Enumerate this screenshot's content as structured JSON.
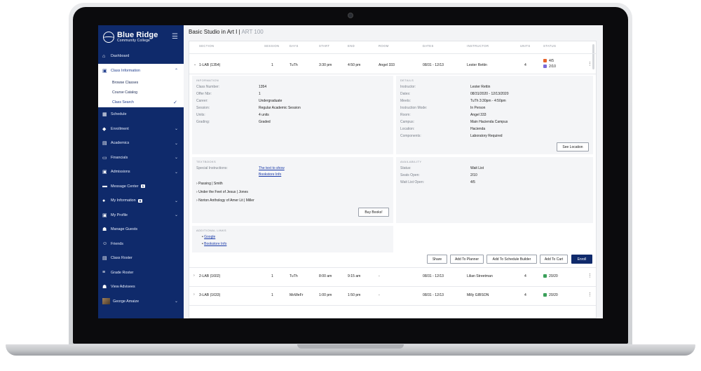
{
  "app": {
    "logo_line1": "Blue Ridge",
    "logo_line2": "Community College",
    "title": "Basic Studio in Art I",
    "course_code": "ART 100"
  },
  "colors": {
    "brand": "#0f2a6b",
    "link": "#1a3aa8",
    "waitlist": "#e8632a",
    "open": "#3aa05a",
    "seats": "#7a6ad8"
  },
  "sidebar": {
    "items": [
      {
        "label": "Dashboard",
        "icon": "home-icon"
      },
      {
        "label": "Class Information",
        "icon": "book-icon"
      },
      {
        "label": "Schedule",
        "icon": "calendar-icon"
      },
      {
        "label": "Enrollment",
        "icon": "graduation-cap-icon"
      },
      {
        "label": "Academics",
        "icon": "library-icon"
      },
      {
        "label": "Financials",
        "icon": "card-icon"
      },
      {
        "label": "Admissions",
        "icon": "id-card-icon"
      },
      {
        "label": "Message Center",
        "icon": "message-icon",
        "badge": "1"
      },
      {
        "label": "My Information",
        "icon": "info-icon",
        "badge": "8"
      },
      {
        "label": "My Profile",
        "icon": "profile-icon"
      },
      {
        "label": "Manage Guests",
        "icon": "guests-icon"
      },
      {
        "label": "Friends",
        "icon": "smile-icon"
      },
      {
        "label": "Class Roster",
        "icon": "roster-icon"
      },
      {
        "label": "Grade Roster",
        "icon": "grade-icon"
      },
      {
        "label": "View Advisees",
        "icon": "advisees-icon"
      },
      {
        "label": "George Amaize",
        "icon": "avatar"
      }
    ],
    "sub_items": [
      "Browse Classes",
      "Course Catalog",
      "Class Search"
    ]
  },
  "table": {
    "headers": [
      "SECTION",
      "SESSION",
      "DAYS",
      "START",
      "END",
      "ROOM",
      "DATES",
      "INSTRUCTOR",
      "UNITS",
      "STATUS"
    ],
    "rows": [
      {
        "section": "1-LAB (1354)",
        "session": "1",
        "days": "TuTh",
        "start": "3:30 pm",
        "end": "4:50 pm",
        "room": "Angel 333",
        "dates": "08/31 - 12/13",
        "instructor": "Lester Rettin",
        "units": "4",
        "status1": "4/5",
        "status2": "2/10"
      },
      {
        "section": "2-LAB (1602)",
        "session": "1",
        "days": "TuTh",
        "start": "8:00 am",
        "end": "9:15 am",
        "room": "-",
        "dates": "08/31 - 12/13",
        "instructor": "Lilian Streetman",
        "units": "4",
        "status1": "20/20"
      },
      {
        "section": "3-LAB (1633)",
        "session": "1",
        "days": "MoWeFr",
        "start": "1:00 pm",
        "end": "1:50 pm",
        "room": "-",
        "dates": "08/31 - 12/13",
        "instructor": "Milly GIBSON",
        "units": "4",
        "status1": "20/20"
      }
    ]
  },
  "information": {
    "title": "INFORMATION",
    "fields": [
      {
        "label": "Class Number:",
        "value": "1354"
      },
      {
        "label": "Offer Nbr:",
        "value": "1"
      },
      {
        "label": "Career:",
        "value": "Undergraduate"
      },
      {
        "label": "Session:",
        "value": "Regular Academic Session"
      },
      {
        "label": "Units:",
        "value": "4 units"
      },
      {
        "label": "Grading:",
        "value": "Graded"
      }
    ]
  },
  "details": {
    "title": "DETAILS",
    "fields": [
      {
        "label": "Instructor:",
        "value": "Lester Rettin"
      },
      {
        "label": "Dates:",
        "value": "08/31/2020 - 12/13/2020"
      },
      {
        "label": "Meets:",
        "value": "TuTh 3:30pm - 4:50pm"
      },
      {
        "label": "Instruction Mode:",
        "value": "In Person"
      },
      {
        "label": "Room:",
        "value": "Angel 333"
      },
      {
        "label": "Campus:",
        "value": "Main Hacienda Campus"
      },
      {
        "label": "Location:",
        "value": "Hacienda"
      },
      {
        "label": "Components:",
        "value": "Laboratory Required"
      }
    ],
    "see_location": "See Location"
  },
  "textbooks": {
    "title": "TEXTBOOKS",
    "instructions_label": "Special Instructions:",
    "link1": "The text to show",
    "link2": "Bookstore Info",
    "books": [
      "Passing | Smith",
      "Under the Feet of Jesus | Jones",
      "Norton Anthology of Amer Lit | Miller"
    ],
    "buy": "Buy Books!"
  },
  "availability": {
    "title": "AVAILABILITY",
    "fields": [
      {
        "label": "Status:",
        "value": "Wait List"
      },
      {
        "label": "Seats Open:",
        "value": "2/10"
      },
      {
        "label": "Wait List Open:",
        "value": "4/5"
      }
    ]
  },
  "links": {
    "title": "ADDITIONAL LINKS",
    "items": [
      "Google",
      "Bookstore Info"
    ]
  },
  "actions": {
    "share": "Share",
    "planner": "Add To Planner",
    "schedule_builder": "Add To Schedule Builder",
    "cart": "Add To Cart",
    "enroll": "Enroll"
  }
}
